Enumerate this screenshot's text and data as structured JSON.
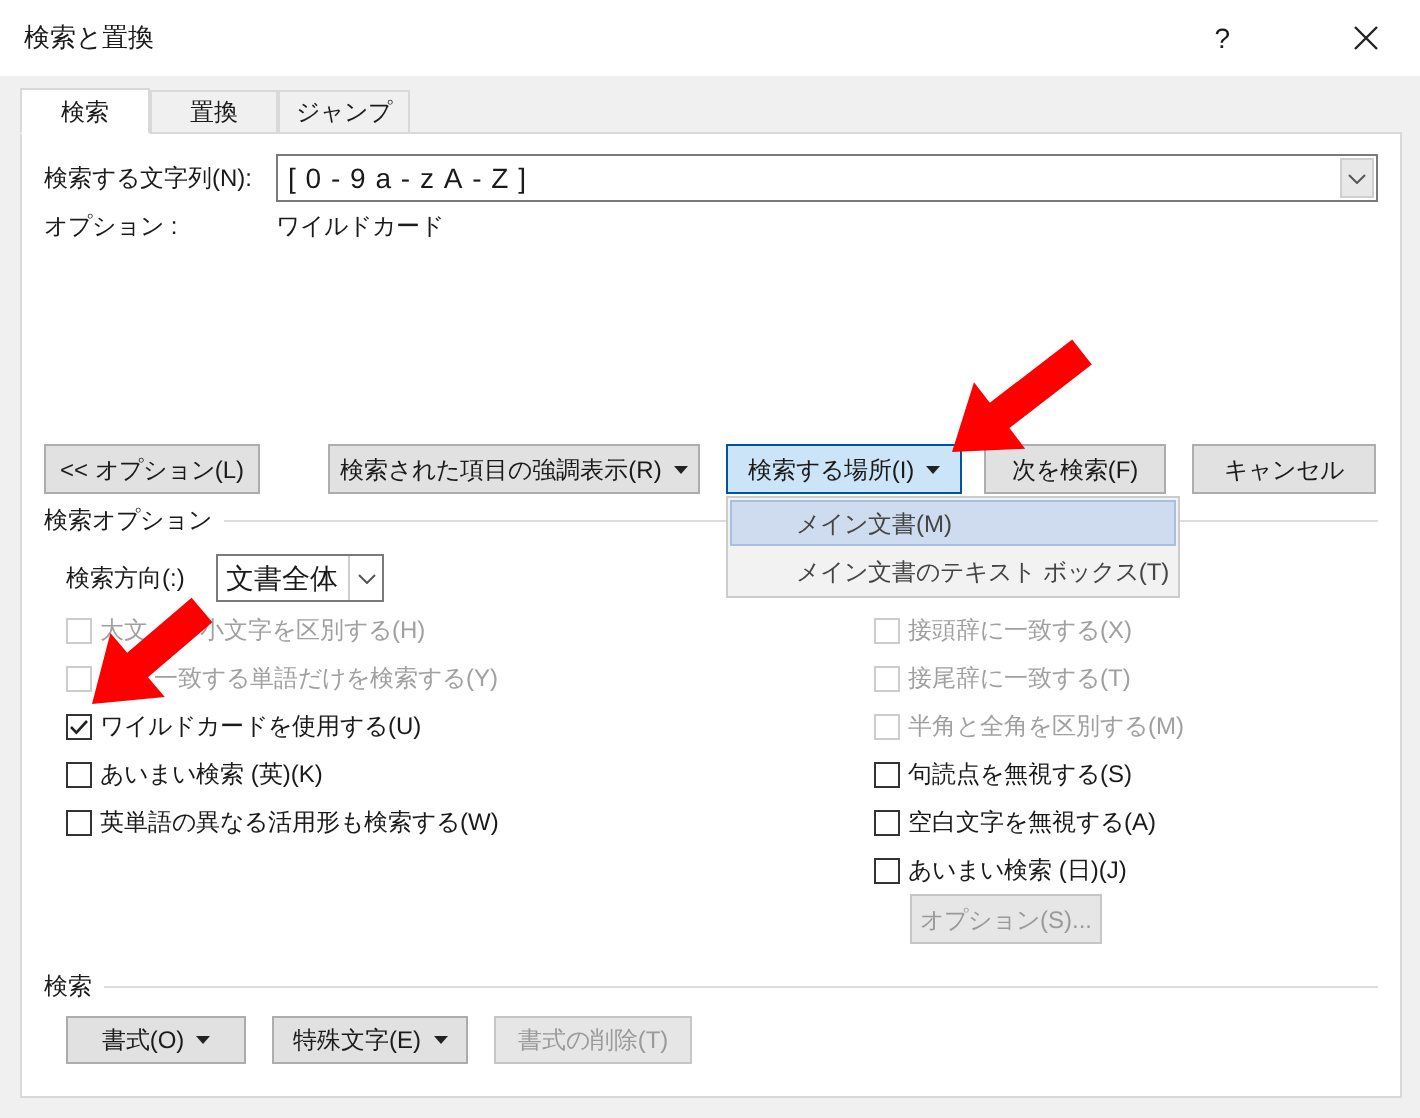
{
  "window": {
    "title": "検索と置換",
    "help": "?"
  },
  "tabs": [
    {
      "label": "検索",
      "selected": true
    },
    {
      "label": "置換",
      "selected": false
    },
    {
      "label": "ジャンプ",
      "selected": false
    }
  ],
  "find": {
    "label": "検索する文字列(N):",
    "value": "[0-9a-zA-Z]"
  },
  "options_line": {
    "label": "オプション :",
    "value": "ワイルドカード"
  },
  "buttons": [
    {
      "label": "<< オプション(L)",
      "dropdown": false,
      "selected": false
    },
    {
      "label": "検索された項目の強調表示(R)",
      "dropdown": true,
      "selected": false
    },
    {
      "label": "検索する場所(I)",
      "dropdown": true,
      "selected": true
    },
    {
      "label": "次を検索(F)",
      "dropdown": false,
      "selected": false
    },
    {
      "label": "キャンセル",
      "dropdown": false,
      "selected": false
    }
  ],
  "menu": {
    "items": [
      {
        "label": "メイン文書(M)",
        "selected": true
      },
      {
        "label": "メイン文書のテキスト ボックス(T)",
        "selected": false
      }
    ]
  },
  "search_options": {
    "title": "検索オプション",
    "direction": {
      "label": "検索方向(:)",
      "value": "文書全体"
    },
    "left": [
      {
        "parts": [
          "大文",
          "小文字を区別する(H)"
        ],
        "checked": false,
        "disabled": true
      },
      {
        "parts": [
          "一致する単語だけを検索する(Y)"
        ],
        "checked": false,
        "disabled": true,
        "obscured": true
      },
      {
        "parts": [
          "ワイルドカードを使用する(U)"
        ],
        "checked": true,
        "disabled": false
      },
      {
        "parts": [
          "あいまい検索 (英)(K)"
        ],
        "checked": false,
        "disabled": false
      },
      {
        "parts": [
          "英単語の異なる活用形も検索する(W)"
        ],
        "checked": false,
        "disabled": false
      }
    ],
    "right": [
      {
        "parts": [
          "接頭辞に一致する(X)"
        ],
        "checked": false,
        "disabled": true
      },
      {
        "parts": [
          "接尾辞に一致する(T)"
        ],
        "checked": false,
        "disabled": true
      },
      {
        "parts": [
          "半角と全角を区別する(M)"
        ],
        "checked": false,
        "disabled": true
      },
      {
        "parts": [
          "句読点を無視する(S)"
        ],
        "checked": false,
        "disabled": false
      },
      {
        "parts": [
          "空白文字を無視する(A)"
        ],
        "checked": false,
        "disabled": false
      },
      {
        "parts": [
          "あいまい検索 (日)(J)"
        ],
        "checked": false,
        "disabled": false
      }
    ],
    "button": {
      "label": "オプション(S)...",
      "disabled": true
    }
  },
  "search_group": {
    "title": "検索",
    "buttons": [
      {
        "label": "書式(O)",
        "dropdown": true,
        "disabled": false
      },
      {
        "label": "特殊文字(E)",
        "dropdown": true,
        "disabled": false
      },
      {
        "label": "書式の削除(T)",
        "dropdown": false,
        "disabled": true
      }
    ]
  }
}
